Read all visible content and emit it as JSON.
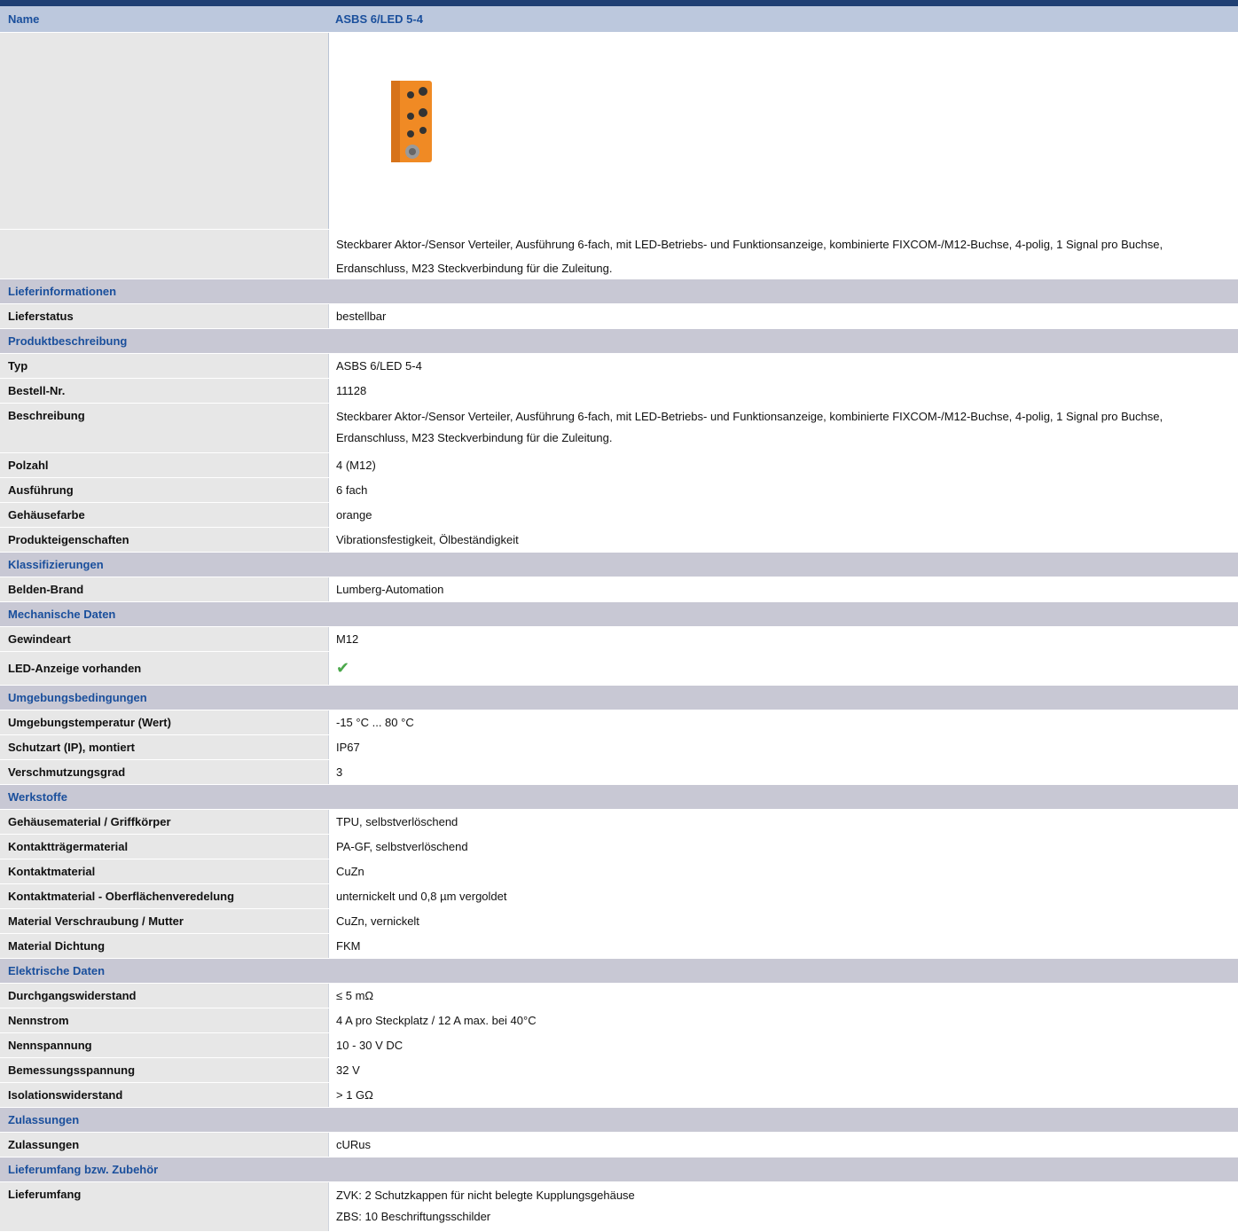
{
  "header": {
    "name_label": "Name",
    "name_value": "ASBS 6/LED 5-4"
  },
  "intro": {
    "image_alt": "product-orange-distributor",
    "description": "Steckbarer Aktor-/Sensor Verteiler, Ausführung 6-fach, mit LED-Betriebs- und Funktionsanzeige, kombinierte FIXCOM-/M12-Buchse, 4-polig, 1 Signal pro Buchse, Erdanschluss, M23 Steckverbindung für die Zuleitung."
  },
  "sections": [
    {
      "title": "Lieferinformationen",
      "rows": [
        {
          "label": "Lieferstatus",
          "value": "bestellbar"
        }
      ]
    },
    {
      "title": "Produktbeschreibung",
      "rows": [
        {
          "label": "Typ",
          "value": "ASBS 6/LED 5-4"
        },
        {
          "label": "Bestell-Nr.",
          "value": "11128"
        },
        {
          "label": "Beschreibung",
          "value": "Steckbarer Aktor-/Sensor Verteiler, Ausführung 6-fach, mit LED-Betriebs- und Funktionsanzeige, kombinierte FIXCOM-/M12-Buchse, 4-polig, 1 Signal pro Buchse, Erdanschluss, M23 Steckverbindung für die Zuleitung."
        },
        {
          "label": "Polzahl",
          "value": "4 (M12)"
        },
        {
          "label": "Ausführung",
          "value": "6 fach"
        },
        {
          "label": "Gehäusefarbe",
          "value": "orange"
        },
        {
          "label": "Produkteigenschaften",
          "value": "Vibrationsfestigkeit, Ölbeständigkeit"
        }
      ]
    },
    {
      "title": "Klassifizierungen",
      "rows": [
        {
          "label": "Belden-Brand",
          "value": "Lumberg-Automation"
        }
      ]
    },
    {
      "title": "Mechanische Daten",
      "rows": [
        {
          "label": "Gewindeart",
          "value": "M12"
        },
        {
          "label": "LED-Anzeige vorhanden",
          "value": "",
          "icon": "checkmark-icon"
        }
      ]
    },
    {
      "title": "Umgebungsbedingungen",
      "rows": [
        {
          "label": "Umgebungstemperatur (Wert)",
          "value": "-15 °C ... 80 °C"
        },
        {
          "label": "Schutzart (IP), montiert",
          "value": "IP67"
        },
        {
          "label": "Verschmutzungsgrad",
          "value": "3"
        }
      ]
    },
    {
      "title": "Werkstoffe",
      "rows": [
        {
          "label": "Gehäusematerial / Griffkörper",
          "value": "TPU, selbstverlöschend"
        },
        {
          "label": "Kontaktträgermaterial",
          "value": "PA-GF, selbstverlöschend"
        },
        {
          "label": "Kontaktmaterial",
          "value": "CuZn"
        },
        {
          "label": "Kontaktmaterial - Oberflächenveredelung",
          "value": "unternickelt und 0,8 µm vergoldet"
        },
        {
          "label": "Material Verschraubung / Mutter",
          "value": "CuZn, vernickelt"
        },
        {
          "label": "Material Dichtung",
          "value": "FKM"
        }
      ]
    },
    {
      "title": "Elektrische Daten",
      "rows": [
        {
          "label": "Durchgangswiderstand",
          "value": "≤ 5 mΩ"
        },
        {
          "label": "Nennstrom",
          "value": "4 A pro Steckplatz / 12 A max. bei 40°C"
        },
        {
          "label": "Nennspannung",
          "value": "10 - 30 V DC"
        },
        {
          "label": "Bemessungsspannung",
          "value": "32 V"
        },
        {
          "label": "Isolationswiderstand",
          "value": "> 1 GΩ"
        }
      ]
    },
    {
      "title": "Zulassungen",
      "rows": [
        {
          "label": "Zulassungen",
          "value": "cURus"
        }
      ]
    },
    {
      "title": "Lieferumfang bzw. Zubehör",
      "rows": [
        {
          "label": "Lieferumfang",
          "value": "ZVK: 2 Schutzkappen für nicht belegte Kupplungsgehäuse\nZBS: 10 Beschriftungsschilder"
        }
      ]
    }
  ]
}
